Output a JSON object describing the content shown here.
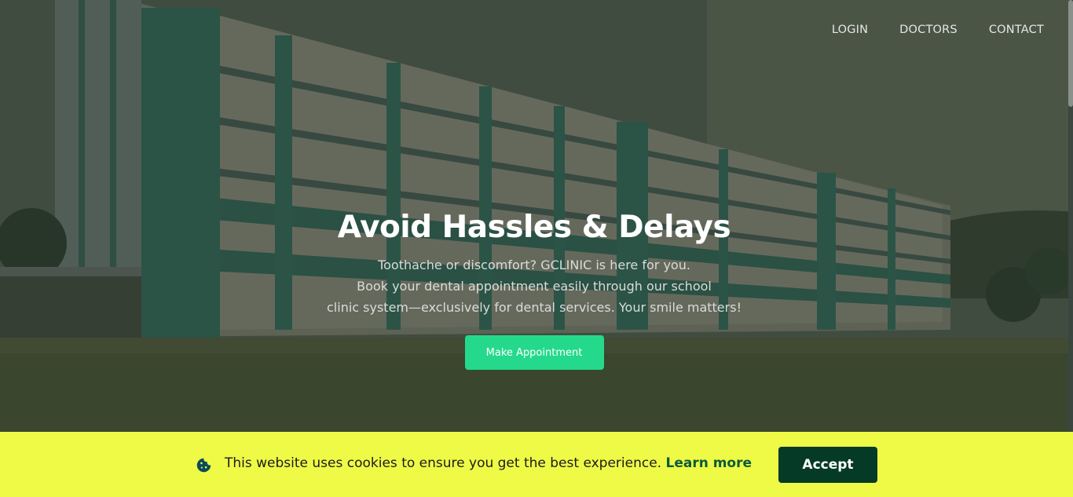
{
  "nav": {
    "login": "LOGIN",
    "doctors": "DOCTORS",
    "contact": "CONTACT"
  },
  "hero": {
    "title": "Avoid Hassles & Delays",
    "lines": [
      "Toothache or discomfort? GCLINIC is here for you.",
      "Book your dental appointment easily through our school",
      "clinic system—exclusively for dental services. Your smile matters!"
    ],
    "cta_label": "Make Appointment"
  },
  "cookie": {
    "icon": "cookie-icon",
    "message": "This website uses cookies to ensure you get the best experience.",
    "link_label": "Learn more",
    "accept_label": "Accept"
  },
  "colors": {
    "cta": "#24d98c",
    "cookie_banner": "#eefa46",
    "accept_button": "#053b26",
    "link": "#0b5a3a"
  }
}
